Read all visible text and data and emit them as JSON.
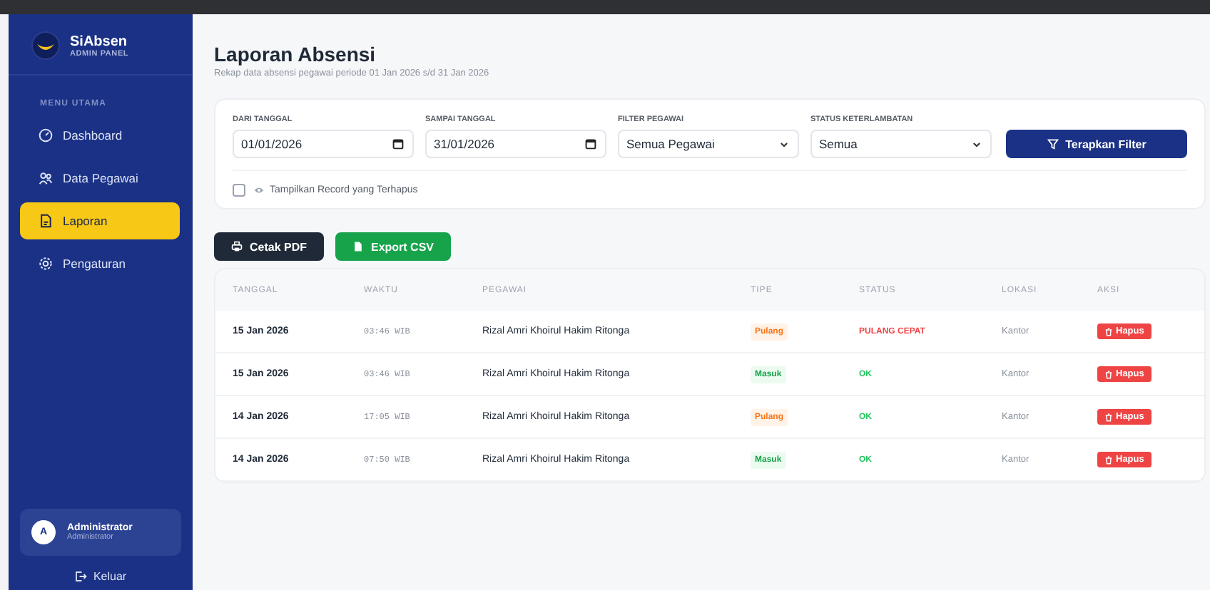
{
  "sidebar": {
    "brand": "SiAbsen",
    "tagline": "ADMIN PANEL",
    "section": "MENU UTAMA",
    "items": [
      {
        "label": "Dashboard",
        "selected": false
      },
      {
        "label": "Data Pegawai",
        "selected": false
      },
      {
        "label": "Laporan",
        "selected": true
      },
      {
        "label": "Pengaturan",
        "selected": false
      }
    ],
    "user": {
      "initial": "A",
      "name": "Administrator",
      "role": "Administrator"
    },
    "logout": "Keluar"
  },
  "header": {
    "title": "Laporan Absensi",
    "subtitle": "Rekap data absensi pegawai periode 01 Jan 2026 s/d 31 Jan 2026"
  },
  "filters": {
    "fields": [
      {
        "label": "DARI TANGGAL",
        "kind": "date",
        "value": "01/01/2026"
      },
      {
        "label": "SAMPAI TANGGAL",
        "kind": "date",
        "value": "31/01/2026"
      },
      {
        "label": "FILTER PEGAWAI",
        "kind": "select",
        "value": "Semua Pegawai"
      },
      {
        "label": "STATUS KETERLAMBATAN",
        "kind": "select",
        "value": "Semua"
      }
    ],
    "apply": "Terapkan Filter",
    "show_deleted": {
      "label": "Tampilkan Record yang Terhapus",
      "checked": false
    }
  },
  "actions": [
    "Cetak PDF",
    "Export CSV"
  ],
  "table": {
    "columns": [
      "TANGGAL",
      "WAKTU",
      "PEGAWAI",
      "TIPE",
      "STATUS",
      "LOKASI",
      "AKSI"
    ],
    "rows": [
      {
        "date": "15 Jan 2026",
        "time": "03:46 WIB",
        "employee": "Rizal Amri Khoirul Hakim Ritonga",
        "type": {
          "text": "Pulang",
          "kind": "out"
        },
        "status": {
          "text": "PULANG CEPAT",
          "kind": "alert"
        },
        "location": "Kantor",
        "action": "Hapus"
      },
      {
        "date": "15 Jan 2026",
        "time": "03:46 WIB",
        "employee": "Rizal Amri Khoirul Hakim Ritonga",
        "type": {
          "text": "Masuk",
          "kind": "in"
        },
        "status": {
          "text": "OK",
          "kind": "ok"
        },
        "location": "Kantor",
        "action": "Hapus"
      },
      {
        "date": "14 Jan 2026",
        "time": "17:05 WIB",
        "employee": "Rizal Amri Khoirul Hakim Ritonga",
        "type": {
          "text": "Pulang",
          "kind": "out"
        },
        "status": {
          "text": "OK",
          "kind": "ok"
        },
        "location": "Kantor",
        "action": "Hapus"
      },
      {
        "date": "14 Jan 2026",
        "time": "07:50 WIB",
        "employee": "Rizal Amri Khoirul Hakim Ritonga",
        "type": {
          "text": "Masuk",
          "kind": "in"
        },
        "status": {
          "text": "OK",
          "kind": "ok"
        },
        "location": "Kantor",
        "action": "Hapus"
      }
    ]
  }
}
